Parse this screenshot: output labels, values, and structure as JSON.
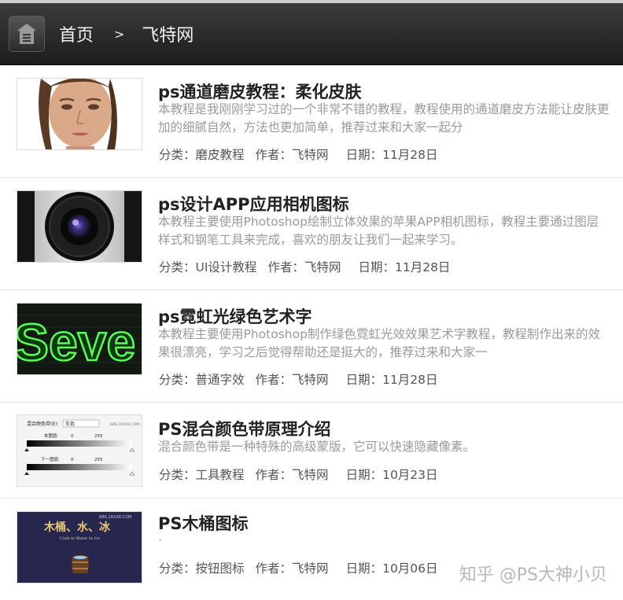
{
  "breadcrumb": {
    "home": "首页",
    "separator": ">",
    "current": "飞特网"
  },
  "labels": {
    "category": "分类：",
    "author": "作者：",
    "date": "日期："
  },
  "articles": [
    {
      "title": "ps通道磨皮教程：柔化皮肤",
      "desc": "本教程是我刚刚学习过的一个非常不错的教程，教程使用的通道磨皮方法能让皮肤更加的细腻自然，方法也更加简单，推荐过来和大家一起分",
      "category": "磨皮教程",
      "author": "飞特网",
      "date": "11月28日"
    },
    {
      "title": "ps设计APP应用相机图标",
      "desc": "本教程主要使用Photoshop绘制立体效果的苹果APP相机图标，教程主要通过图层样式和钢笔工具来完成，喜欢的朋友让我们一起来学习。",
      "category": "UI设计教程",
      "author": "飞特网",
      "date": "11月28日"
    },
    {
      "title": "ps霓虹光绿色艺术字",
      "desc": "本教程主要使用Photoshop制作绿色霓虹光效效果艺术字教程，教程制作出来的效果很漂亮，学习之后觉得帮助还是挺大的，推荐过来和大家一",
      "category": "普通字效",
      "author": "飞特网",
      "date": "11月28日"
    },
    {
      "title": "PS混合颜色带原理介绍",
      "desc": "混合颜色带是一种特殊的高级蒙版，它可以快速隐藏像素。",
      "category": "工具教程",
      "author": "飞特网",
      "date": "10月23日"
    },
    {
      "title": "PS木桶图标",
      "desc": "·",
      "category": "按钮图标",
      "author": "飞特网",
      "date": "10月06日"
    }
  ],
  "thumbs": {
    "neon_text": "Seve",
    "blend_panel": {
      "mode_label": "混合颜色带(E):",
      "mode_value": "灰色",
      "this_layer": "本图层:",
      "under_layer": "下一图层:",
      "low": "0",
      "high": "255",
      "site": "BBS.16XX8.COM"
    },
    "barrel": {
      "title": "木桶、水、冰",
      "subtitle": "Cask in Water in Ice",
      "site": "BBS.16XX8.COM"
    }
  },
  "watermark": "知乎 @PS大神小贝"
}
